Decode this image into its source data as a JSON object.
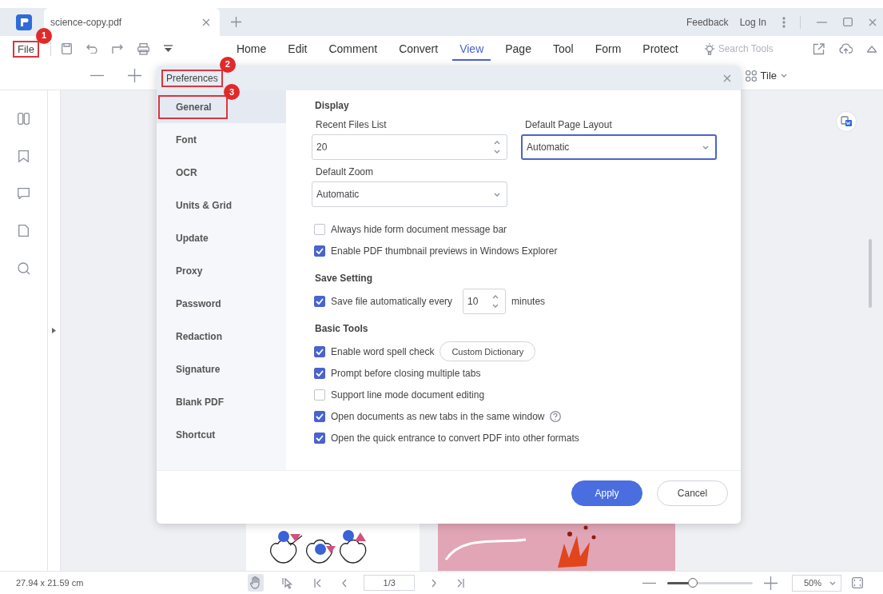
{
  "tabs": [
    {
      "label": "science-copy.pdf",
      "selected": true
    }
  ],
  "title_bar": {
    "links": [
      "Feedback",
      "Log In"
    ]
  },
  "toolbar": {
    "file": {
      "label": "File",
      "callout": "1"
    },
    "menu": [
      {
        "label": "Home",
        "selected": false
      },
      {
        "label": "Edit",
        "selected": false
      },
      {
        "label": "Comment",
        "selected": false
      },
      {
        "label": "Convert",
        "selected": false
      },
      {
        "label": "View",
        "selected": true
      },
      {
        "label": "Page",
        "selected": false
      },
      {
        "label": "Tool",
        "selected": false
      },
      {
        "label": "Form",
        "selected": false
      },
      {
        "label": "Protect",
        "selected": false
      }
    ],
    "search": {
      "placeholder": "Search Tools"
    }
  },
  "view_bar": {
    "layout": "Tile"
  },
  "dialog": {
    "title": "Preferences",
    "title_callout": "2",
    "nav": [
      {
        "label": "General",
        "selected": true,
        "callout": "3"
      },
      {
        "label": "Font",
        "selected": false
      },
      {
        "label": "OCR",
        "selected": false
      },
      {
        "label": "Units & Grid",
        "selected": false
      },
      {
        "label": "Update",
        "selected": false
      },
      {
        "label": "Proxy",
        "selected": false
      },
      {
        "label": "Password",
        "selected": false
      },
      {
        "label": "Redaction",
        "selected": false
      },
      {
        "label": "Signature",
        "selected": false
      },
      {
        "label": "Blank PDF",
        "selected": false
      },
      {
        "label": "Shortcut",
        "selected": false
      }
    ],
    "sections": [
      {
        "heading": "Display",
        "rows": [
          {
            "kind": "fields",
            "fields": [
              {
                "kind": "spinner",
                "label": "Recent Files List",
                "value": "20"
              },
              {
                "kind": "select",
                "label": "Default Page Layout",
                "value": "Automatic",
                "focused": true
              }
            ]
          },
          {
            "kind": "fields",
            "fields": [
              {
                "kind": "select",
                "label": "Default Zoom",
                "value": "Automatic",
                "focused": false
              }
            ]
          },
          {
            "kind": "checkbox",
            "label": "Always hide form document message bar",
            "checked": false
          },
          {
            "kind": "checkbox",
            "label": "Enable PDF thumbnail previews in Windows Explorer",
            "checked": true
          }
        ]
      },
      {
        "heading": "Save Setting",
        "rows": [
          {
            "kind": "checkbox",
            "label": "Save file automatically every",
            "checked": true,
            "spinner": "10",
            "suffix": "minutes"
          }
        ]
      },
      {
        "heading": "Basic Tools",
        "rows": [
          {
            "kind": "checkbox",
            "label": "Enable word spell check",
            "checked": true,
            "button": "Custom Dictionary"
          },
          {
            "kind": "checkbox",
            "label": "Prompt before closing multiple tabs",
            "checked": true
          },
          {
            "kind": "checkbox",
            "label": "Support line mode document editing",
            "checked": false
          },
          {
            "kind": "checkbox",
            "label": "Open documents as new tabs in the same window",
            "checked": true,
            "help": true
          },
          {
            "kind": "checkbox",
            "label": "Open the quick entrance to convert PDF into other formats",
            "checked": true
          }
        ]
      }
    ],
    "buttons": [
      {
        "label": "Apply",
        "primary": true
      },
      {
        "label": "Cancel",
        "primary": false
      }
    ]
  },
  "status_bar": {
    "size": "27.94 x 21.59 cm",
    "page": "1/3",
    "zoom_slider": {
      "level": 0.3
    },
    "zoom": "50%"
  }
}
